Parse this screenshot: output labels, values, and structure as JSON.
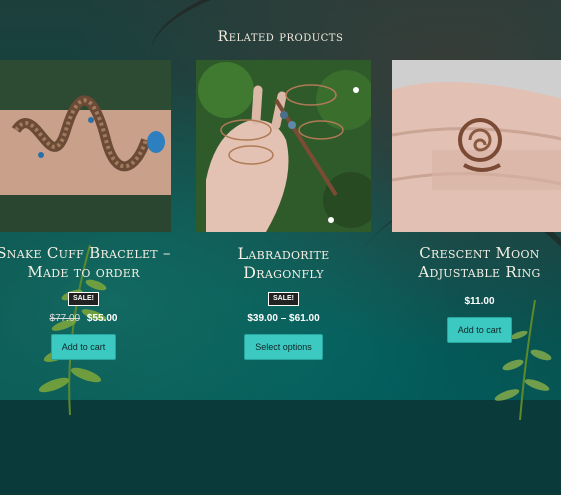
{
  "section": {
    "heading": "Related products"
  },
  "products": [
    {
      "title": "Snake Cuff Bracelet – Made to order",
      "sale_badge": "SALE!",
      "old_price": "$77.00",
      "price": "$55.00",
      "button": "Add to cart"
    },
    {
      "title": "Labradorite Dragonfly",
      "sale_badge": "SALE!",
      "price_range": "$39.00 – $61.00",
      "button": "Select options"
    },
    {
      "title": "Crescent Moon Adjustable Ring",
      "price": "$11.00",
      "button": "Add to cart"
    }
  ],
  "colors": {
    "button": "#3bc9c1",
    "title": "#f4efe4",
    "background": "#0b3a3a"
  }
}
